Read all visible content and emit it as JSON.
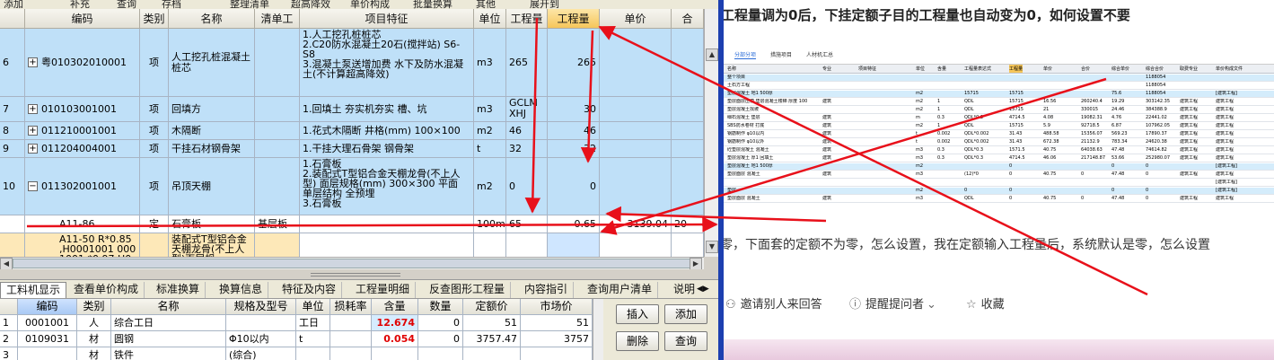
{
  "menu": [
    "添加",
    "补充",
    "查询",
    "存档",
    "整理清单",
    "超高降效",
    "单价构成",
    "批量换算",
    "其他",
    "展开到"
  ],
  "grid": {
    "headers": {
      "code": "编码",
      "type": "类别",
      "name": "名称",
      "list": "清单工",
      "feature": "项目特征",
      "unit": "单位",
      "qty_expr": "工程量",
      "qty": "工程量",
      "price": "单价",
      "total": "合"
    },
    "rows": [
      {
        "num": "6",
        "expander": "+",
        "code": "粤010302010001",
        "type": "项",
        "name": "人工挖孔桩混凝土桩芯",
        "list": "",
        "feature": "1.人工挖孔桩桩芯\n2.C20防水混凝土20石(搅拌站) S6-S8\n3.混凝土泵送增加费 水下及防水混凝土(不计算超高降效)",
        "unit": "m3",
        "qty_expr": "265",
        "qty": "265",
        "price": "",
        "total": ""
      },
      {
        "num": "7",
        "expander": "+",
        "code": "010103001001",
        "type": "项",
        "name": "回填方",
        "list": "",
        "feature": "1.回填土 夯实机夯实 槽、坑",
        "unit": "m3",
        "qty_expr": "GCLMXHJ",
        "qty": "30",
        "price": "",
        "total": ""
      },
      {
        "num": "8",
        "expander": "+",
        "code": "011210001001",
        "type": "项",
        "name": "木隔断",
        "list": "",
        "feature": "1.花式木隔断 井格(mm) 100×100",
        "unit": "m2",
        "qty_expr": "46",
        "qty": "46",
        "price": "",
        "total": ""
      },
      {
        "num": "9",
        "expander": "+",
        "code": "011204004001",
        "type": "项",
        "name": "干挂石材钢骨架",
        "list": "",
        "feature": "1.干挂大理石骨架 钢骨架",
        "unit": "t",
        "qty_expr": "32",
        "qty": "32",
        "price": "",
        "total": ""
      },
      {
        "num": "10",
        "expander": "−",
        "code": "011302001001",
        "type": "项",
        "name": "吊顶天棚",
        "list": "",
        "feature": "1.石膏板\n2.装配式T型铝合金天棚龙骨(不上人型) 面层规格(mm) 300×300 平面 单层结构 全预埋\n3.石膏板",
        "unit": "m2",
        "qty_expr": "0",
        "qty": "0",
        "price": "",
        "total": ""
      },
      {
        "num": "",
        "expander": "",
        "code": "A11-86",
        "type": "定",
        "name": "石膏板",
        "list": "基层板",
        "feature": "",
        "unit": "100m2",
        "qty_expr": "65",
        "qty": "0.65",
        "price": "3139.04",
        "total": "20"
      },
      {
        "num": "",
        "expander": "",
        "code": "A11-50 R*0.85\n,H0001001 000\n1001 *0.97 H0",
        "type": "",
        "name": "装配式T型铝合金天棚龙骨(不上人型)面层规",
        "list": "",
        "feature": "",
        "unit": "",
        "qty_expr": "",
        "qty": "",
        "price": "",
        "total": ""
      }
    ]
  },
  "tabs": [
    "工料机显示",
    "查看单价构成",
    "标准换算",
    "换算信息",
    "特征及内容",
    "工程量明细",
    "反查图形工程量",
    "内容指引",
    "查询用户清单",
    "说明"
  ],
  "subgrid": {
    "headers": {
      "code": "编码",
      "type": "类别",
      "name": "名称",
      "spec": "规格及型号",
      "unit": "单位",
      "loss": "损耗率",
      "content": "含量",
      "qty": "数量",
      "quota_price": "定额价",
      "market_price": "市场价"
    },
    "rows": [
      {
        "num": "1",
        "code": "0001001",
        "type": "人",
        "name": "综合工日",
        "spec": "",
        "unit": "工日",
        "loss": "",
        "content": "12.674",
        "qty": "0",
        "quota_price": "51",
        "market_price": "51"
      },
      {
        "num": "2",
        "code": "0109031",
        "type": "材",
        "name": "圆钢",
        "spec": "Φ10以内",
        "unit": "t",
        "loss": "",
        "content": "0.054",
        "qty": "0",
        "quota_price": "3757.47",
        "market_price": "3757"
      },
      {
        "num": "3",
        "code": "",
        "type": "材",
        "name": "铁件",
        "spec": "(综合)",
        "unit": "",
        "loss": "",
        "content": "",
        "qty": "",
        "quota_price": "",
        "market_price": ""
      }
    ]
  },
  "buttons": {
    "insert": "插入",
    "add": "添加",
    "delete": "删除",
    "query": "查询"
  },
  "question": {
    "title": "工程量调为0后，下挂定额子目的工程量也自动变为0，如何设置不要",
    "body": "零，下面套的定额不为零，怎么设置，我在定额输入工程量后，系统默认是零，怎么设置",
    "actions": {
      "invite": "邀请别人来回答",
      "remind": "提醒提问者",
      "favorite": "收藏"
    }
  },
  "embedded": {
    "tabs": [
      "分部分项",
      "措施项目",
      "人材机汇总"
    ],
    "headers": [
      "名称",
      "专业",
      "项目特征",
      "单位",
      "含量",
      "工程量表达式",
      "工程量",
      "单价",
      "合价",
      "综合单价",
      "综合合价",
      "取费专业",
      "单价构成文件"
    ],
    "rows": [
      [
        "整个项目",
        "",
        "",
        "",
        "",
        "",
        "",
        "",
        "",
        "",
        "1188054",
        "",
        ""
      ],
      [
        "土石方工程",
        "",
        "",
        "",
        "",
        "",
        "",
        "",
        "",
        "",
        "1188054",
        "",
        ""
      ],
      [
        "垫层混凝土 地1 500厚",
        "",
        "",
        "m2",
        "",
        "15715",
        "15715",
        "",
        "",
        "75.6",
        "1188054",
        "",
        "[建筑工程]"
      ],
      [
        "垫层面层压模 垫层混凝土楼梯 厚度 100",
        "建筑",
        "",
        "m2",
        "1",
        "QDL",
        "15715",
        "16.56",
        "260240.4",
        "19.29",
        "303142.35",
        "建筑工程",
        "建筑工程"
      ],
      [
        "垫层混凝土找坡",
        "",
        "",
        "m2",
        "1",
        "QDL",
        "15715",
        "21",
        "330015",
        "24.46",
        "384388.9",
        "建筑工程",
        "建筑工程"
      ],
      [
        "细石混凝土 垫层",
        "建筑",
        "",
        "m",
        "0.3",
        "QDL*0.3",
        "4714.5",
        "4.08",
        "19082.31",
        "4.76",
        "22441.02",
        "建筑工程",
        "建筑工程"
      ],
      [
        "SBS防水卷材 打底",
        "建筑",
        "",
        "m2",
        "1",
        "QDL",
        "15715",
        "5.9",
        "92718.5",
        "6.87",
        "107962.05",
        "建筑工程",
        "建筑工程"
      ],
      [
        "钢筋制作 φ10以内",
        "建筑",
        "",
        "t",
        "0.002",
        "QDL*0.002",
        "31.43",
        "488.58",
        "15356.07",
        "569.23",
        "17890.37",
        "建筑工程",
        "建筑工程"
      ],
      [
        "钢筋制作 φ10以外",
        "建筑",
        "",
        "t",
        "0.002",
        "QDL*0.002",
        "31.43",
        "672.38",
        "21132.9",
        "783.34",
        "24620.38",
        "建筑工程",
        "建筑工程"
      ],
      [
        "砼垫层混凝土 混凝土",
        "建筑",
        "",
        "m3",
        "0.3",
        "QDL*0.3",
        "1571.5",
        "40.75",
        "64038.63",
        "47.48",
        "74614.82",
        "建筑工程",
        "建筑工程"
      ],
      [
        "垫层混凝土 厚1 回填土",
        "建筑",
        "",
        "m3",
        "0.3",
        "QDL*0.3",
        "4714.5",
        "46.06",
        "217148.87",
        "53.66",
        "252980.07",
        "建筑工程",
        "建筑工程"
      ],
      [
        "垫层混凝土 地1 500厚",
        "",
        "",
        "m2",
        "",
        "",
        "0",
        "",
        "",
        "0",
        "0",
        "",
        "[建筑工程]"
      ],
      [
        "垫层面层 混凝土",
        "建筑",
        "",
        "m3",
        "",
        "(12)*0",
        "0",
        "40.75",
        "0",
        "47.48",
        "0",
        "建筑工程",
        "建筑工程"
      ],
      [
        "",
        "",
        "",
        "",
        "",
        "",
        "",
        "",
        "",
        "",
        "",
        "",
        "[建筑工程]"
      ],
      [
        "垫层",
        "",
        "",
        "m2",
        "",
        "0",
        "0",
        "",
        "",
        "0",
        "0",
        "",
        "[建筑工程]"
      ],
      [
        "垫层面层 混凝土",
        "建筑",
        "",
        "m3",
        "",
        "QDL",
        "0",
        "40.75",
        "0",
        "47.48",
        "0",
        "建筑工程",
        "建筑工程"
      ]
    ]
  },
  "colors": {
    "accent_red": "#e00000",
    "row_blue": "#bfe0f8",
    "header_orange": "#f6c65a",
    "divider_blue": "#1c3fb0"
  }
}
